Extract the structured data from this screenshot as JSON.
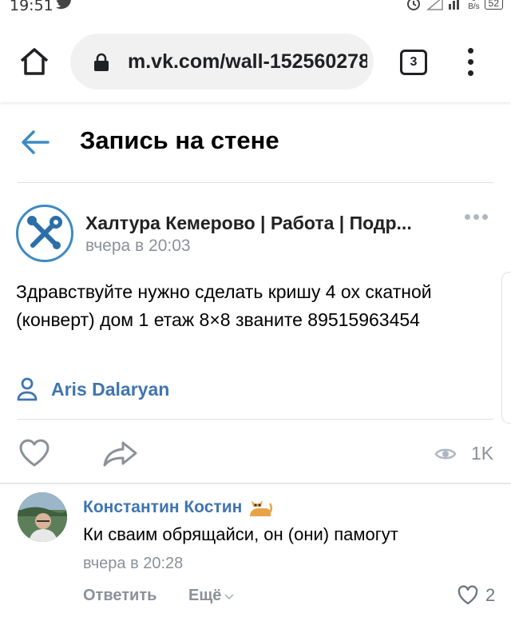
{
  "status_bar": {
    "time": "19:51",
    "network_speed": "0\nB/s",
    "battery": "52"
  },
  "browser": {
    "url": "m.vk.com/wall-152560278",
    "tab_count": "3"
  },
  "header": {
    "title": "Запись на стене"
  },
  "post": {
    "group_name": "Халтура Кемерово | Работа | Подр...",
    "time": "вчера в 20:03",
    "text": "Здравствуйте нужно сделать кришу 4 ох скатной (конверт) дом 1 етаж 8×8 званите 89515963454",
    "author": "Aris Dalaryan",
    "views": "1K"
  },
  "comment": {
    "author": "Константин Костин",
    "text": "Ки сваим обрящайси, он (они) памогут",
    "time": "вчера в 20:28",
    "reply_label": "Ответить",
    "more_label": "Ещё",
    "likes": "2"
  },
  "colors": {
    "accent": "#3f75b0",
    "muted": "#8a9199",
    "icon_blue": "#3d8ac3"
  },
  "icons": [
    "twitter-icon",
    "alarm-icon",
    "signal-icon",
    "battery-icon",
    "home-icon",
    "lock-icon",
    "tabs-icon",
    "menu-icon",
    "back-arrow-icon",
    "group-avatar-tools-icon",
    "more-icon",
    "person-icon",
    "heart-icon",
    "share-icon",
    "eye-icon",
    "cat-emoji-icon",
    "chevron-down-icon"
  ]
}
